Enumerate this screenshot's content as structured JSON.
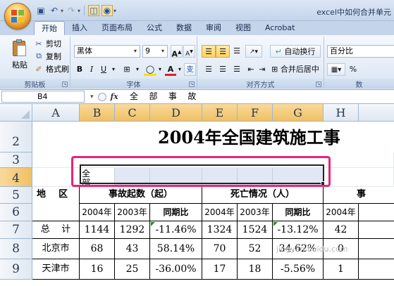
{
  "window": {
    "title": "excel中如何合并单元"
  },
  "quick_access": {
    "icons": [
      "save-icon",
      "undo-icon",
      "redo-icon",
      "print-preview-icon",
      "camera-icon"
    ]
  },
  "ribbon_tabs": [
    "开始",
    "插入",
    "页面布局",
    "公式",
    "数据",
    "审阅",
    "视图",
    "Acrobat"
  ],
  "clipboard": {
    "paste": "粘贴",
    "cut": "剪切",
    "copy": "复制",
    "format_painter": "格式刷",
    "group_label": "剪贴板"
  },
  "font": {
    "name": "黑体",
    "size": "9",
    "bold": "B",
    "italic": "I",
    "underline": "U",
    "grow": "A",
    "shrink": "A",
    "wen": "变",
    "group_label": "字体"
  },
  "alignment": {
    "wrap_text": "自动换行",
    "merge_center": "合并后居中",
    "group_label": "对齐方式"
  },
  "number": {
    "format": "百分比",
    "percent": "%",
    "group_label": "数"
  },
  "formula_bar": {
    "name_box": "B4",
    "fx": "fx",
    "content": "全   部   事   故"
  },
  "columns": [
    "A",
    "B",
    "C",
    "D",
    "E",
    "F",
    "G",
    "H"
  ],
  "rows": [
    "2",
    "3",
    "4",
    "5",
    "6",
    "7",
    "8",
    "9"
  ],
  "sheet": {
    "title": "2004年全国建筑施工事",
    "b4_text": "全\n部",
    "row5": {
      "a": "地    区",
      "bc": "事故起数（起）",
      "ef": "死亡情况（人）",
      "h": "事"
    },
    "row6": [
      "2004年",
      "2003年",
      "同期比",
      "2004年",
      "2003年",
      "同期比",
      "2004年"
    ],
    "data_rows": [
      {
        "region": "总    计",
        "values": [
          "1144",
          "1292",
          "-11.46%",
          "1324",
          "1524",
          "-13.12%",
          "42"
        ]
      },
      {
        "region": "北京市",
        "values": [
          "68",
          "43",
          "58.14%",
          "70",
          "52",
          "34.62%",
          "0"
        ]
      },
      {
        "region": "天津市",
        "values": [
          "16",
          "25",
          "-36.00%",
          "17",
          "18",
          "-5.56%",
          "1"
        ]
      }
    ],
    "watermark": "jingyan.baidu.com"
  },
  "colors": {
    "highlight": "#e8247a",
    "selection": "#e1e7f3",
    "header_selected": "#f0c064"
  }
}
